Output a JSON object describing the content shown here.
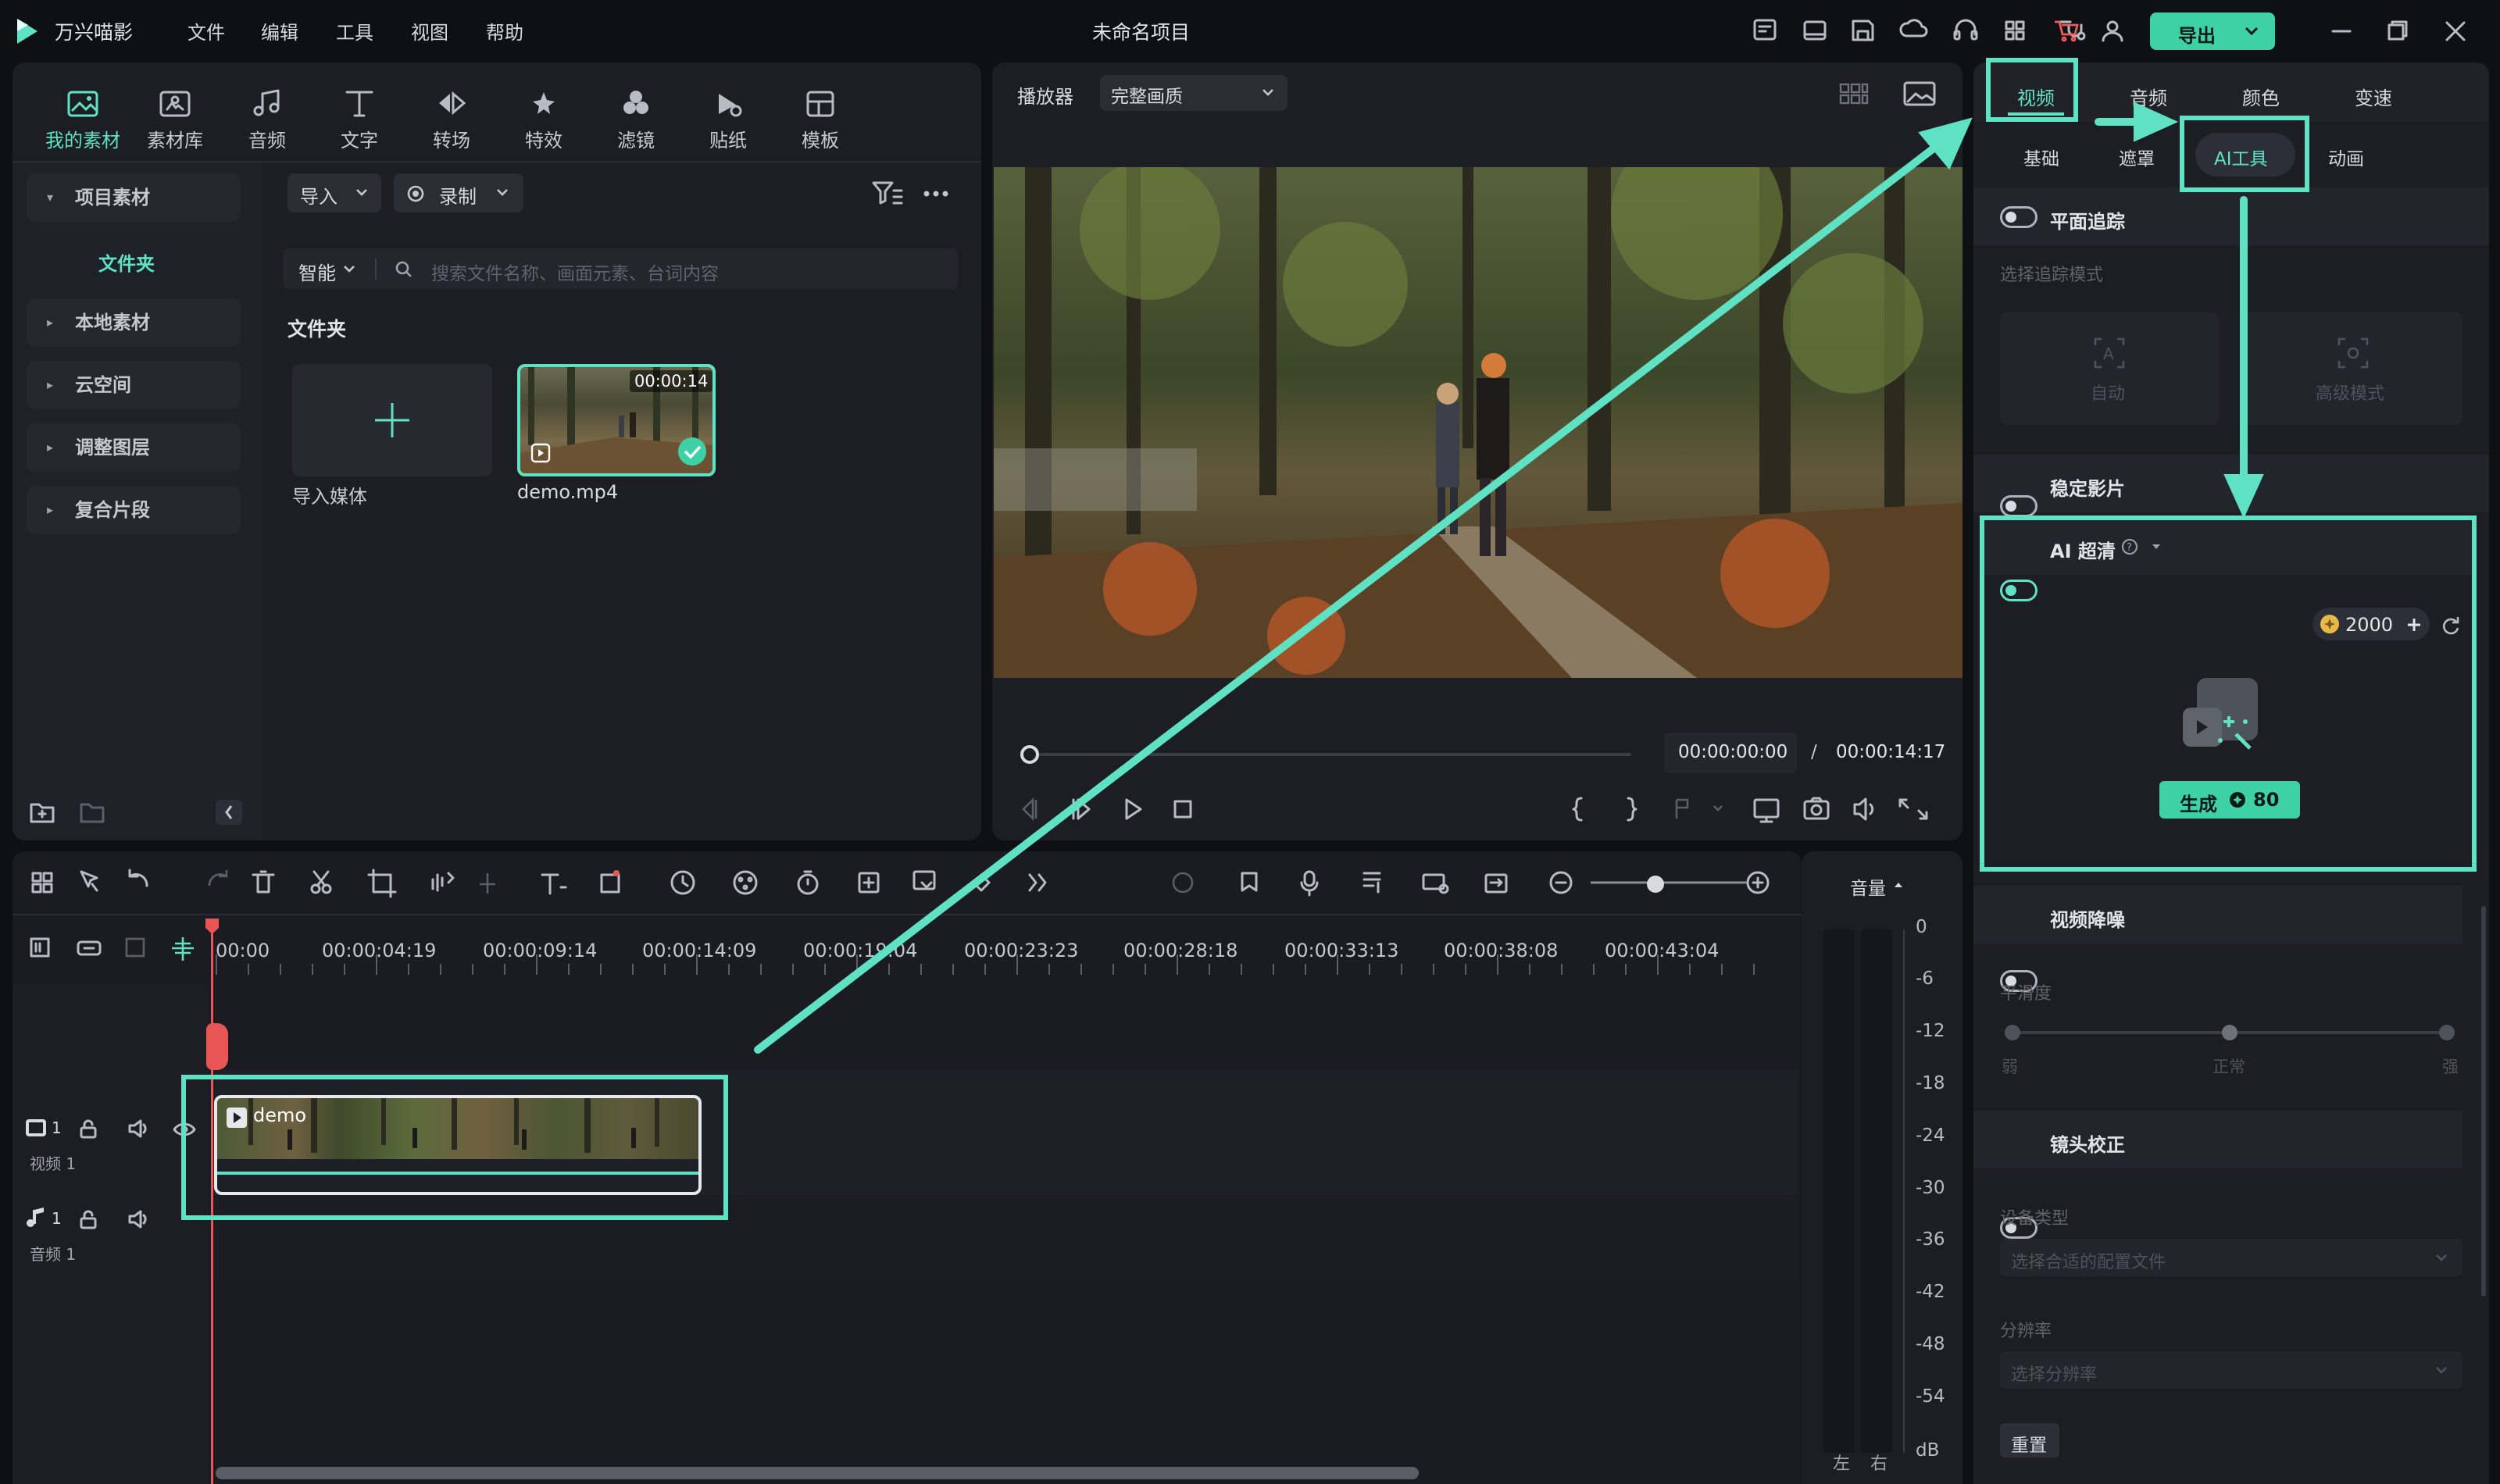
{
  "app": {
    "name": "万兴喵影",
    "project_title": "未命名项目"
  },
  "menu": [
    "文件",
    "编辑",
    "工具",
    "视图",
    "帮助"
  ],
  "export_label": "导出",
  "toolbar_tabs": [
    {
      "label": "我的素材",
      "icon": "media-icon",
      "active": true
    },
    {
      "label": "素材库",
      "icon": "stock-library-icon"
    },
    {
      "label": "音频",
      "icon": "music-note-icon"
    },
    {
      "label": "文字",
      "icon": "text-icon"
    },
    {
      "label": "转场",
      "icon": "transition-icon"
    },
    {
      "label": "特效",
      "icon": "effects-icon"
    },
    {
      "label": "滤镜",
      "icon": "filter-icon"
    },
    {
      "label": "贴纸",
      "icon": "sticker-icon"
    },
    {
      "label": "模板",
      "icon": "template-icon"
    }
  ],
  "sidebar": {
    "items": [
      {
        "label": "项目素材",
        "expanded": true
      },
      {
        "label": "文件夹",
        "active": true
      },
      {
        "label": "本地素材"
      },
      {
        "label": "云空间"
      },
      {
        "label": "调整图层"
      },
      {
        "label": "复合片段"
      }
    ]
  },
  "media": {
    "import_label": "导入",
    "record_label": "录制",
    "smart_label": "智能",
    "search_placeholder": "搜索文件名称、画面元素、台词内容",
    "folder_title": "文件夹",
    "import_media_label": "导入媒体",
    "clip": {
      "name": "demo.mp4",
      "duration": "00:00:14"
    }
  },
  "player": {
    "label": "播放器",
    "quality": "完整画质",
    "current_time": "00:00:00:00",
    "separator": "/",
    "total_time": "00:00:14:17",
    "progress": 0
  },
  "timeline": {
    "ruler": [
      "00:00",
      "00:00:04:19",
      "00:00:09:14",
      "00:00:14:09",
      "00:00:19:04",
      "00:00:23:23",
      "00:00:28:18",
      "00:00:33:13",
      "00:00:38:08",
      "00:00:43:04"
    ],
    "video_track": {
      "number": "1",
      "label": "视频 1"
    },
    "audio_track": {
      "number": "1",
      "label": "音频 1"
    },
    "clip_name": "demo",
    "zoom_level": 0.44
  },
  "audio_meter": {
    "title": "音量",
    "scale": [
      "0",
      "-6",
      "-12",
      "-18",
      "-24",
      "-30",
      "-36",
      "-42",
      "-48",
      "-54",
      "dB"
    ],
    "left": "左",
    "right": "右"
  },
  "inspector": {
    "tabs": [
      {
        "label": "视频",
        "active": true
      },
      {
        "label": "音频"
      },
      {
        "label": "颜色"
      },
      {
        "label": "变速"
      }
    ],
    "subtabs": [
      {
        "label": "基础"
      },
      {
        "label": "遮罩"
      },
      {
        "label": "AI工具",
        "active": true
      },
      {
        "label": "动画"
      }
    ],
    "motion_tracking": {
      "label": "平面追踪",
      "on": false,
      "mode_label": "选择追踪模式",
      "auto_label": "自动",
      "advanced_label": "高级模式"
    },
    "stabilization": {
      "label": "稳定影片",
      "on": false
    },
    "ai_enhance": {
      "label": "AI 超清",
      "on": true,
      "credits": "2000",
      "generate_label": "生成",
      "generate_cost": "80"
    },
    "denoise": {
      "label": "视频降噪",
      "on": false,
      "smoothness_label": "平滑度",
      "levels": [
        "弱",
        "正常",
        "强"
      ],
      "smoothness_value": 0.5
    },
    "lens": {
      "label": "镜头校正",
      "on": false,
      "device_label": "设备类型",
      "device_placeholder": "选择合适的配置文件",
      "resolution_label": "分辨率",
      "resolution_placeholder": "选择分辨率",
      "reset_label": "重置"
    }
  },
  "colors": {
    "accent": "#5fe2c4",
    "playhead": "#e85555",
    "export_button": "#3ed1a6"
  }
}
